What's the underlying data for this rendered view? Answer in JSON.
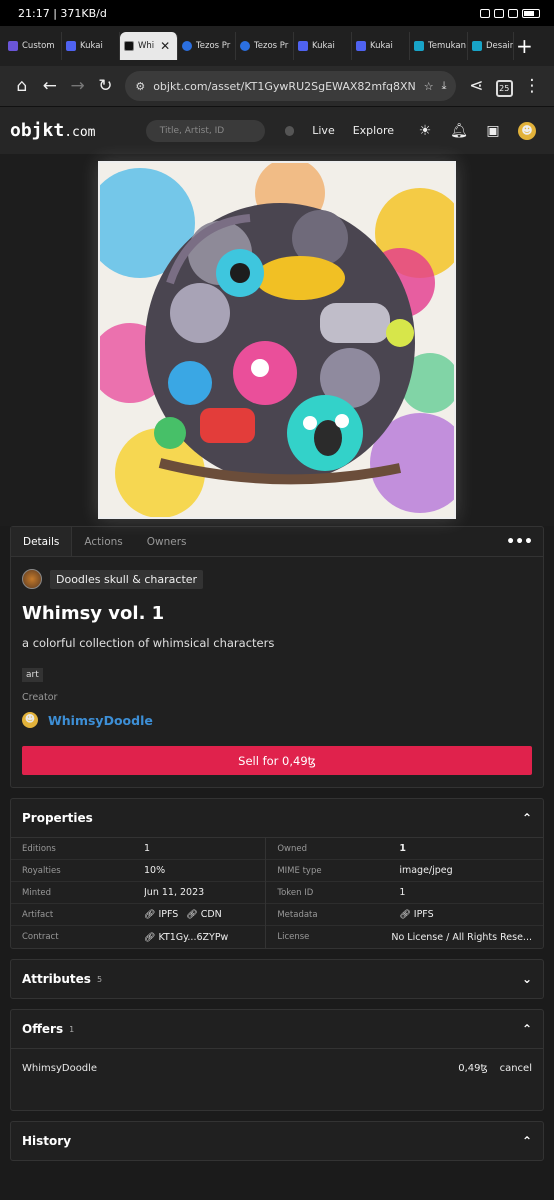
{
  "status": {
    "time_speed": "21:17 | 371KB/d"
  },
  "browser_tabs": [
    {
      "label": "Custom",
      "color": "#6a55d8"
    },
    {
      "label": "Kukai",
      "color": "#4f62f0"
    },
    {
      "label": "Whi",
      "color": "#111111"
    },
    {
      "label": "Tezos Pr",
      "color": "#2b6fe0"
    },
    {
      "label": "Tezos Pr",
      "color": "#2b6fe0"
    },
    {
      "label": "Kukai",
      "color": "#4f62f0"
    },
    {
      "label": "Kukai",
      "color": "#4f62f0"
    },
    {
      "label": "Temukan",
      "color": "#18a4c8"
    },
    {
      "label": "Desain",
      "color": "#18a4c8"
    }
  ],
  "address": {
    "url": "objkt.com/asset/KT1GywRU2SgEWAX82mfq8XN",
    "tab_count": "25"
  },
  "site": {
    "logo_main": "objkt",
    "logo_suffix": ".com",
    "search_placeholder": "Title, Artist, ID",
    "nav_live": "Live",
    "nav_explore": "Explore"
  },
  "detail_tabs": [
    "Details",
    "Actions",
    "Owners"
  ],
  "token": {
    "collection": "Doodles skull & character",
    "title": "Whimsy vol. 1",
    "description": "a colorful collection of whimsical characters",
    "tag": "art",
    "creator_label": "Creator",
    "creator_name": "WhimsyDoodle",
    "sell_label": "Sell for 0,49ꜩ"
  },
  "properties": {
    "title": "Properties",
    "left": [
      {
        "key": "Editions",
        "value": "1"
      },
      {
        "key": "Royalties",
        "value": "10%"
      },
      {
        "key": "Minted",
        "value": "Jun 11, 2023"
      },
      {
        "key": "Artifact",
        "value": "IPFS",
        "value2": "CDN"
      },
      {
        "key": "Contract",
        "value": "KT1Gy...6ZYPw"
      }
    ],
    "right": [
      {
        "key": "Owned",
        "value": "1"
      },
      {
        "key": "MIME type",
        "value": "image/jpeg"
      },
      {
        "key": "Token ID",
        "value": "1"
      },
      {
        "key": "Metadata",
        "value": "IPFS"
      },
      {
        "key": "License",
        "value": "No License / All Rights Rese..."
      }
    ]
  },
  "attributes": {
    "title": "Attributes",
    "count": "5"
  },
  "offers": {
    "title": "Offers",
    "count": "1",
    "rows": [
      {
        "from": "WhimsyDoodle",
        "price": "0,49ꜩ",
        "action": "cancel"
      }
    ]
  },
  "history": {
    "title": "History"
  }
}
